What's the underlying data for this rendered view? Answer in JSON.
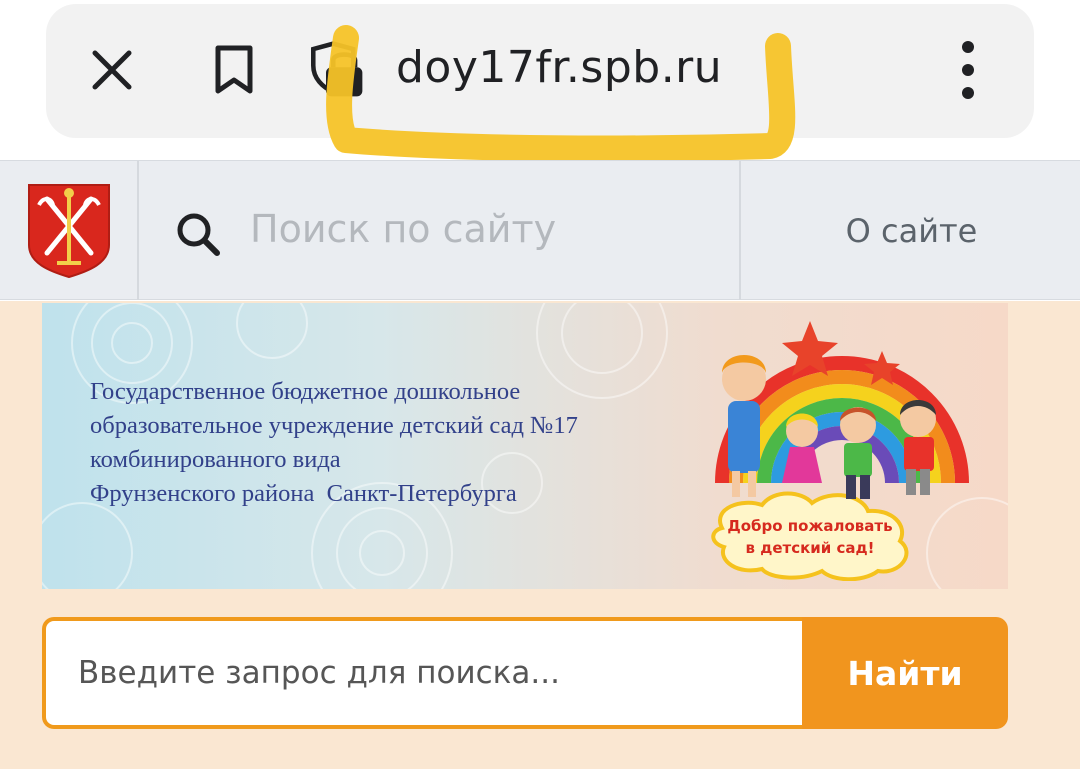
{
  "browser": {
    "url": "doy17fr.spb.ru",
    "icons": [
      "close-icon",
      "bookmark-icon",
      "site-security-icon",
      "more-vert-icon"
    ],
    "highlight_color": "#f6c328"
  },
  "header": {
    "emblem_icon": "spb-coat-of-arms-icon",
    "search_placeholder": "Поиск по сайту",
    "about_label": "О сайте"
  },
  "banner": {
    "lines": [
      "Государственное бюджетное дошкольное",
      "образовательное учреждение детский сад №17",
      "комбинированного вида",
      "Фрунзенского района  Санкт-Петербурга"
    ],
    "welcome_line1": "Добро пожаловать",
    "welcome_line2": "в детский сад!"
  },
  "search": {
    "placeholder": "Введите запрос для поиска...",
    "button_label": "Найти"
  },
  "colors": {
    "accent": "#f1951e",
    "page_bg": "#fae7d2",
    "header_bg": "#eaedf1",
    "banner_text": "#32418a"
  }
}
